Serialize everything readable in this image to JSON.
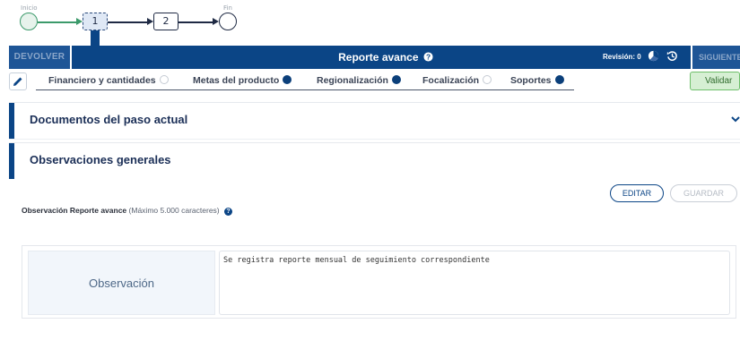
{
  "flow": {
    "start_label": "Inicio",
    "end_label": "Fin",
    "step1": "1",
    "step2": "2",
    "colors": {
      "start": "#3c9a6b",
      "current": "#2b4a7b"
    }
  },
  "header": {
    "left_button": "DEVOLVER",
    "title": "Reporte avance",
    "revision_label": "Revisión: 0",
    "right_button": "SIGUIENTE",
    "bg_color": "#0b4586"
  },
  "tabs": [
    {
      "label": "Financiero y cantidades",
      "status": "empty"
    },
    {
      "label": "Metas del producto",
      "status": "filled"
    },
    {
      "label": "Regionalización",
      "status": "filled"
    },
    {
      "label": "Focalización",
      "status": "empty"
    },
    {
      "label": "Soportes",
      "status": "filled"
    }
  ],
  "validar_label": "Validar",
  "sections": {
    "documentos_title": "Documentos del paso actual",
    "observaciones_title": "Observaciones generales"
  },
  "observacion": {
    "label": "Observación Reporte avance",
    "hint": "(Máximo 5.000 caracteres)",
    "editar_label": "EDITAR",
    "guardar_label": "GUARDAR",
    "row_header": "Observación",
    "text": "Se registra reporte mensual de seguimiento correspondiente"
  },
  "icons": {
    "pencil": "pencil-icon",
    "help": "question-circle-icon",
    "chart": "pie-chart-icon",
    "history": "history-icon",
    "chevron": "chevron-down-icon"
  }
}
